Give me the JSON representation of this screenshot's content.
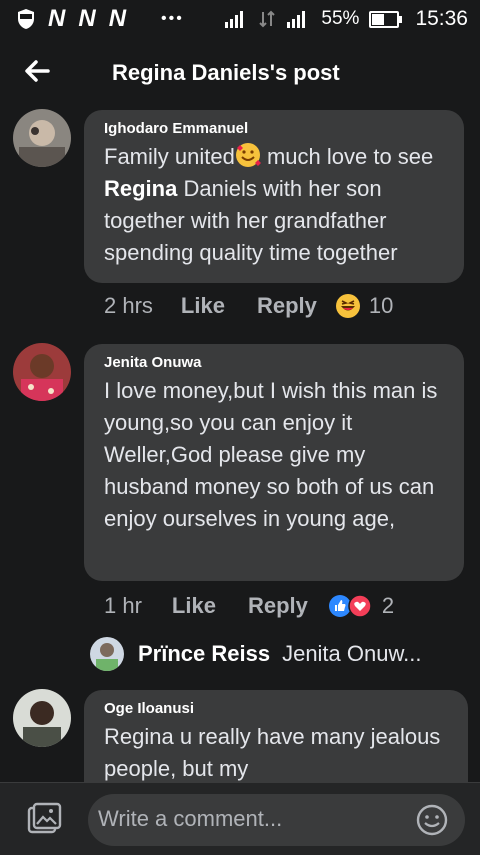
{
  "status": {
    "time": "15:36",
    "battery": "55%",
    "battery_level": 0.55,
    "carrier_icons": [
      "N",
      "N",
      "N"
    ]
  },
  "header": {
    "title": "Regina Daniels's post"
  },
  "comments": [
    {
      "author": "Ighodaro Emmanuel",
      "text_before": "Family united",
      "text_after": " much love to see ",
      "bold": "Regina",
      "text_end": " Daniels with her son together with her grandfather spending quality time together",
      "time": "2 hrs",
      "like": "Like",
      "reply": "Reply",
      "reaction_count": "10",
      "reaction_icon": "haha-emoji-icon"
    },
    {
      "author": "Jenita Onuwa",
      "text": "I love money,but I wish this man is young,so you can enjoy it Weller,God please give my husband money so both of us can enjoy ourselves in young age,",
      "time": "1 hr",
      "like": "Like",
      "reply": "Reply",
      "reaction_count": "2",
      "reaction_icons": [
        "like-reaction-icon",
        "love-reaction-icon"
      ]
    },
    {
      "author": "Oge Iloanusi",
      "text": "Regina u really have many jealous people, but my"
    }
  ],
  "reply_preview": {
    "name": "Prïnce Reiss",
    "snippet": "Jenita Onuw..."
  },
  "composer": {
    "placeholder": "Write a comment..."
  }
}
